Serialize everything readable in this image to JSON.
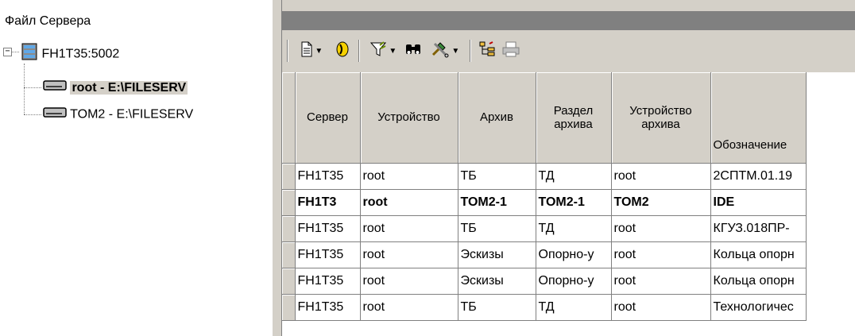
{
  "tree": {
    "header": "Файл Сервера",
    "server": {
      "label": "FH1T35:5002",
      "expander": "−"
    },
    "volumes": [
      {
        "label": "root - E:\\FILESERV",
        "selected": true
      },
      {
        "label": "TOM2 - E:\\FILESERV",
        "selected": false
      }
    ]
  },
  "toolbar": {
    "buttons": [
      {
        "name": "new-document",
        "icon": "document-icon",
        "dropdown": true
      },
      {
        "name": "mark",
        "icon": "bookmark-icon",
        "dropdown": false
      },
      {
        "name": "filter",
        "icon": "filter-icon",
        "dropdown": true
      },
      {
        "name": "find",
        "icon": "binoculars-icon",
        "dropdown": false
      },
      {
        "name": "tools",
        "icon": "tools-icon",
        "dropdown": true
      },
      {
        "name": "structure",
        "icon": "tree-structure-icon",
        "dropdown": false
      },
      {
        "name": "print",
        "icon": "printer-icon",
        "dropdown": false
      }
    ]
  },
  "grid": {
    "columns": [
      "Сервер",
      "Устройство",
      "Архив",
      "Раздел архива",
      "Устройство архива",
      "Обозначение"
    ],
    "rows": [
      {
        "bold": false,
        "cells": [
          "FH1T35",
          "root",
          "ТБ",
          "ТД",
          "root",
          "2СПТМ.01.19"
        ]
      },
      {
        "bold": true,
        "cells": [
          "FH1T3",
          "root",
          "TOM2-1",
          "TOM2-1",
          "TOM2",
          "IDE"
        ]
      },
      {
        "bold": false,
        "cells": [
          "FH1T35",
          "root",
          "ТБ",
          "ТД",
          "root",
          "КГУЗ.018ПР-"
        ]
      },
      {
        "bold": false,
        "cells": [
          "FH1T35",
          "root",
          "Эскизы",
          "Опорно-у",
          "root",
          "Кольца опорн"
        ]
      },
      {
        "bold": false,
        "cells": [
          "FH1T35",
          "root",
          "Эскизы",
          "Опорно-у",
          "root",
          "Кольца опорн"
        ]
      },
      {
        "bold": false,
        "cells": [
          "FH1T35",
          "root",
          "ТБ",
          "ТД",
          "root",
          "Технологичес"
        ]
      }
    ]
  }
}
